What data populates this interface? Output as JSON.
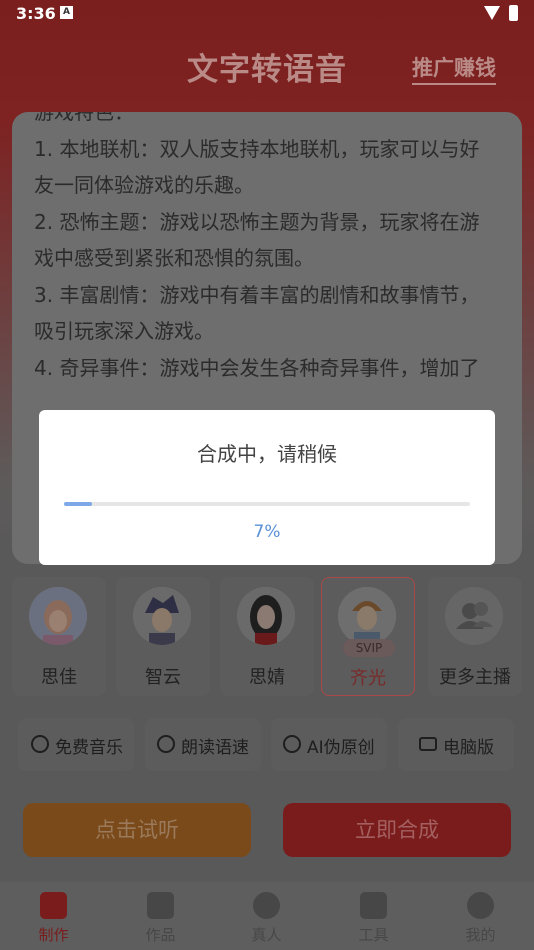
{
  "status_bar": {
    "time": "3:36",
    "notification": "A"
  },
  "header": {
    "title": "文字转语音",
    "promo_link": "推广赚钱"
  },
  "text_card": {
    "lines": [
      "游戏特色：",
      "1. 本地联机：双人版支持本地联机，玩家可以与好",
      "友一同体验游戏的乐趣。",
      "2. 恐怖主题：游戏以恐怖主题为背景，玩家将在游",
      "戏中感受到紧张和恐惧的氛围。",
      "3. 丰富剧情：游戏中有着丰富的剧情和故事情节，",
      "吸引玩家深入游戏。",
      "4. 奇异事件：游戏中会发生各种奇异事件，增加了"
    ]
  },
  "anchors": [
    {
      "name": "思佳"
    },
    {
      "name": "智云"
    },
    {
      "name": "思婧"
    },
    {
      "name": "齐光",
      "badge": "SVIP",
      "selected": true
    },
    {
      "name": "更多主播"
    }
  ],
  "tools": [
    {
      "label": "免费音乐",
      "icon": "music-note-icon"
    },
    {
      "label": "朗读语速",
      "icon": "waveform-icon"
    },
    {
      "label": "AI伪原创",
      "icon": "ai-icon"
    },
    {
      "label": "电脑版",
      "icon": "monitor-icon"
    }
  ],
  "actions": {
    "listen": "点击试听",
    "synthesize": "立即合成"
  },
  "tabs": [
    {
      "label": "制作",
      "icon": "home-icon",
      "active": true
    },
    {
      "label": "作品",
      "icon": "folder-icon"
    },
    {
      "label": "真人",
      "icon": "people-icon"
    },
    {
      "label": "工具",
      "icon": "toolbox-icon"
    },
    {
      "label": "我的",
      "icon": "profile-icon"
    }
  ],
  "dialog": {
    "title": "合成中，请稍候",
    "percent_text": "7%",
    "progress": 0.07
  },
  "colors": {
    "brand_red": "#d23a3a",
    "progress_blue": "#5a8fd8",
    "listen_orange": "#f29a2e"
  }
}
